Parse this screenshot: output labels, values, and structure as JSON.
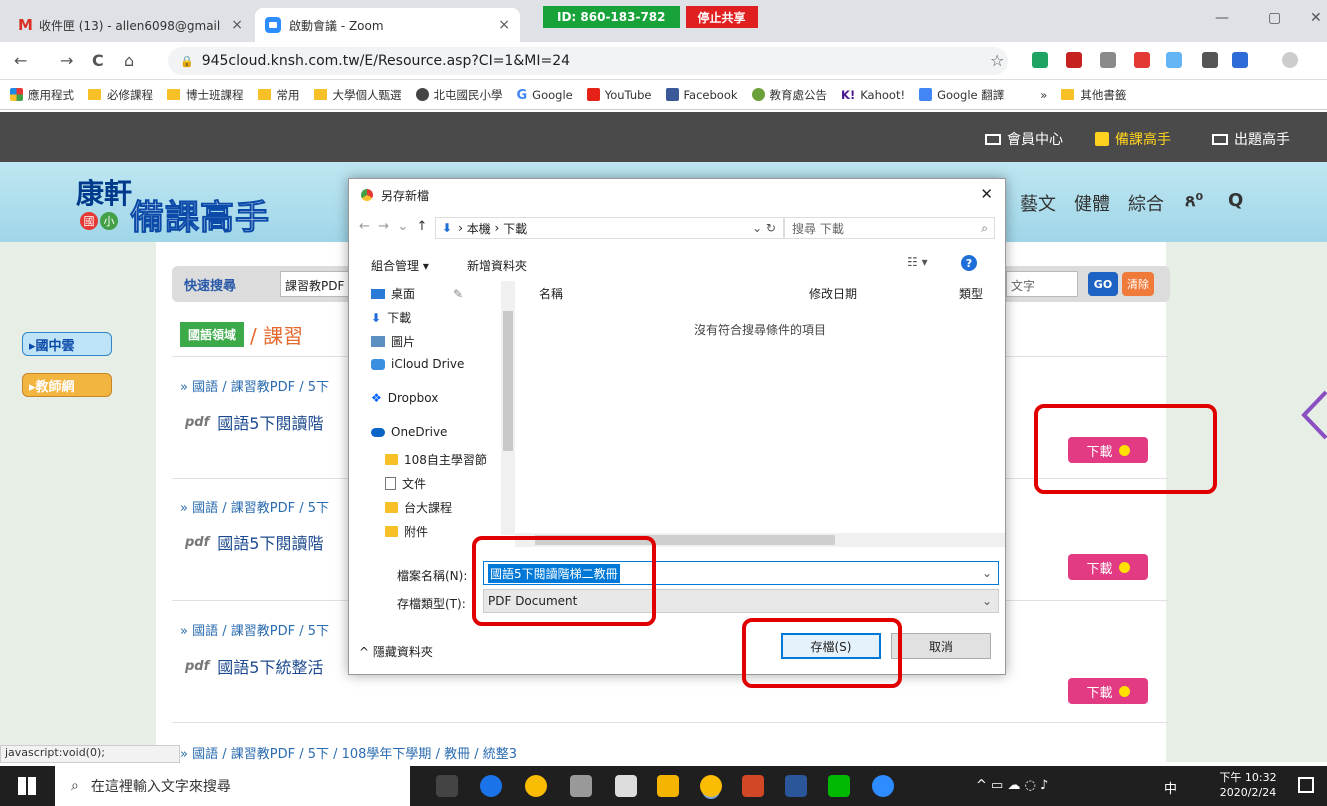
{
  "browser": {
    "tabs": [
      {
        "title": "收件匣 (13) - allen6098@gmail",
        "close": "×"
      },
      {
        "title": "啟動會議 - Zoom",
        "close": "×"
      }
    ],
    "zoom_bar": {
      "meeting_id": "ID: 860-183-782",
      "stop_share": "停止共享"
    },
    "window_controls": {
      "minimize": "—",
      "restore": "▢",
      "close": "✕"
    },
    "nav": {
      "back": "←",
      "forward": "→",
      "reload": "C",
      "home": "⌂"
    },
    "url": "945cloud.knsh.com.tw/E/Resource.asp?CI=1&MI=24",
    "star": "☆",
    "bookmarks": [
      "應用程式",
      "必修課程",
      "博士班課程",
      "常用",
      "大學個人甄選",
      "北屯國民小學",
      "Google",
      "YouTube",
      "Facebook",
      "教育處公告",
      "Kahoot!",
      "Google 翻譯",
      "»",
      "其他書籤"
    ]
  },
  "site": {
    "topbar": {
      "member": "會員中心",
      "prep": "備課高手",
      "quiz": "出題高手"
    },
    "logo": {
      "brand": "康軒",
      "badge1": "國",
      "badge2": "小",
      "product": "備課高手"
    },
    "nav": {
      "items": [
        "藝文",
        "健體",
        "綜合"
      ],
      "user": "ጸ⁰",
      "search": "Q"
    },
    "side": {
      "btn1": "▸國中雲",
      "btn2": "▸教師網"
    },
    "search": {
      "label": "快速搜尋",
      "value": "課習教PDF",
      "hint": "文字",
      "go": "GO",
      "clear": "清除"
    },
    "section": {
      "domain": "國語領域",
      "title": "/ 課習"
    },
    "rows": [
      {
        "crumb": "» 國語 / 課習教PDF / 5下",
        "pdf": "pdf",
        "title": "國語5下閱讀階",
        "dl": "下載"
      },
      {
        "crumb": "» 國語 / 課習教PDF / 5下",
        "pdf": "pdf",
        "title": "國語5下閱讀階",
        "dl": "下載"
      },
      {
        "crumb": "» 國語 / 課習教PDF / 5下",
        "pdf": "pdf",
        "title": "國語5下統整活",
        "dl": "下載"
      }
    ],
    "bottom_crumb": "» 國語 / 課習教PDF / 5下 / 108學年下學期 / 教冊 / 統整3",
    "status_text": "javascript:void(0);"
  },
  "dialog": {
    "title": "另存新檔",
    "close": "✕",
    "path": [
      "本機",
      "下載"
    ],
    "search_placeholder": "搜尋 下載",
    "organize": "組合管理 ▾",
    "new_folder": "新增資料夾",
    "tree": [
      "桌面",
      "下載",
      "圖片",
      "iCloud Drive",
      "Dropbox",
      "OneDrive",
      "108自主學習節",
      "文件",
      "台大課程",
      "附件"
    ],
    "columns": {
      "name": "名稱",
      "date": "修改日期",
      "type": "類型"
    },
    "empty": "沒有符合搜尋條件的項目",
    "filename_label": "檔案名稱(N):",
    "filename": "國語5下閱讀階梯二教冊",
    "filetype_label": "存檔類型(T):",
    "filetype": "PDF Document",
    "hide_folders": "^ 隱藏資料夾",
    "save": "存檔(S)",
    "cancel": "取消"
  },
  "taskbar": {
    "search": "在這裡輸入文字來搜尋",
    "time": "下午 10:32",
    "date": "2020/2/24",
    "ime": "中"
  }
}
